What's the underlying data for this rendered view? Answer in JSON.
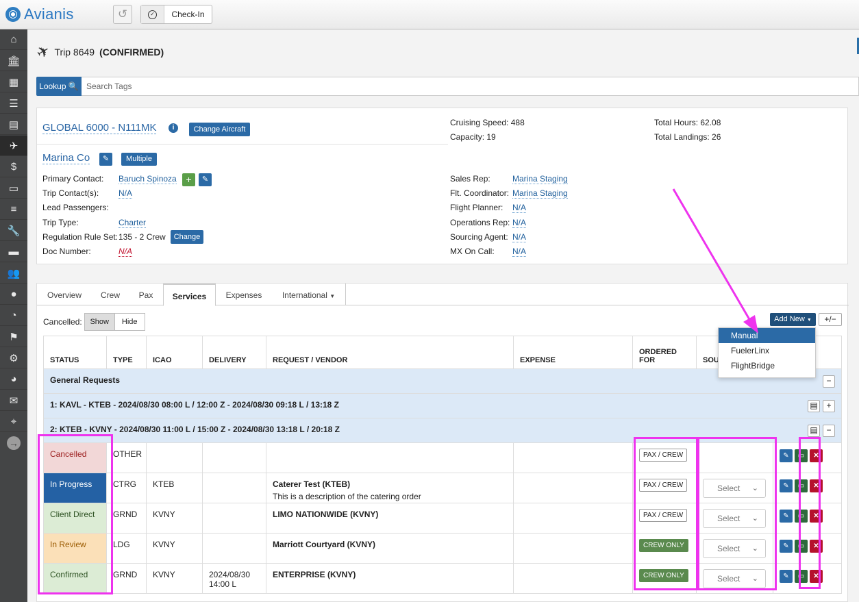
{
  "app": {
    "brand": "Avianis",
    "checkin_label": "Check-In"
  },
  "trip": {
    "title": "Trip 8649",
    "status": "(CONFIRMED)"
  },
  "search": {
    "lookup_label": "Lookup",
    "placeholder": "Search Tags"
  },
  "aircraft": {
    "name": "GLOBAL 6000 - N111MK",
    "change_label": "Change Aircraft",
    "cruise": "Cruising Speed: 488",
    "capacity": "Capacity: 19",
    "total_hours": "Total Hours: 62.08",
    "total_landings": "Total Landings: 26"
  },
  "client": {
    "name": "Marina Co",
    "multiple_label": "Multiple",
    "primary_contact_label": "Primary Contact:",
    "primary_contact": "Baruch Spinoza",
    "trip_contacts_label": "Trip Contact(s):",
    "trip_contacts": "N/A",
    "lead_pax_label": "Lead Passengers:",
    "trip_type_label": "Trip Type:",
    "trip_type": "Charter",
    "rule_label": "Regulation Rule Set:",
    "rule": "135 - 2 Crew",
    "rule_change": "Change",
    "doc_label": "Doc Number:",
    "doc": "N/A"
  },
  "staff": [
    {
      "label": "Sales Rep:",
      "value": "Marina Staging"
    },
    {
      "label": "Flt. Coordinator:",
      "value": "Marina Staging"
    },
    {
      "label": "Flight Planner:",
      "value": "N/A"
    },
    {
      "label": "Operations Rep:",
      "value": "N/A"
    },
    {
      "label": "Sourcing Agent:",
      "value": "N/A"
    },
    {
      "label": "MX On Call:",
      "value": "N/A"
    }
  ],
  "tabs": [
    "Overview",
    "Crew",
    "Pax",
    "Services",
    "Expenses",
    "International"
  ],
  "services": {
    "cancelled_label": "Cancelled:",
    "show": "Show",
    "hide": "Hide",
    "add_new": "Add New",
    "plus_minus": "+/−",
    "columns": [
      "STATUS",
      "TYPE",
      "ICAO",
      "DELIVERY",
      "REQUEST / VENDOR",
      "EXPENSE",
      "ORDERED FOR",
      "SOU"
    ],
    "groups": [
      "General Requests",
      "1: KAVL - KTEB - 2024/08/30 08:00 L / 12:00 Z - 2024/08/30 09:18 L / 13:18 Z",
      "2: KTEB - KVNY - 2024/08/30 11:00 L / 15:00 Z - 2024/08/30 13:18 L / 20:18 Z"
    ],
    "rows": [
      {
        "status": "Cancelled",
        "type": "OTHER",
        "icao": "",
        "delivery": "",
        "vendor": "",
        "desc": "",
        "ordered": "PAX / CREW"
      },
      {
        "status": "In Progress",
        "type": "CTRG",
        "icao": "KTEB",
        "delivery": "",
        "vendor": "Caterer Test (KTEB)",
        "desc": "This is a description of the catering order",
        "ordered": "PAX / CREW"
      },
      {
        "status": "Client Direct",
        "type": "GRND",
        "icao": "KVNY",
        "delivery": "",
        "vendor": "LIMO NATIONWIDE (KVNY)",
        "desc": "",
        "ordered": "PAX / CREW"
      },
      {
        "status": "In Review",
        "type": "LDG",
        "icao": "KVNY",
        "delivery": "",
        "vendor": "Marriott Courtyard (KVNY)",
        "desc": "",
        "ordered": "CREW ONLY"
      },
      {
        "status": "Confirmed",
        "type": "GRND",
        "icao": "KVNY",
        "delivery": "2024/08/30 14:00 L",
        "vendor": "ENTERPRISE (KVNY)",
        "desc": "",
        "ordered": "CREW ONLY"
      }
    ],
    "select_placeholder": "Select"
  },
  "add_menu": [
    "Manual",
    "FuelerLinx",
    "FlightBridge"
  ],
  "colors": {
    "accent": "#2b6aa6",
    "highlight": "#ee33ee"
  }
}
